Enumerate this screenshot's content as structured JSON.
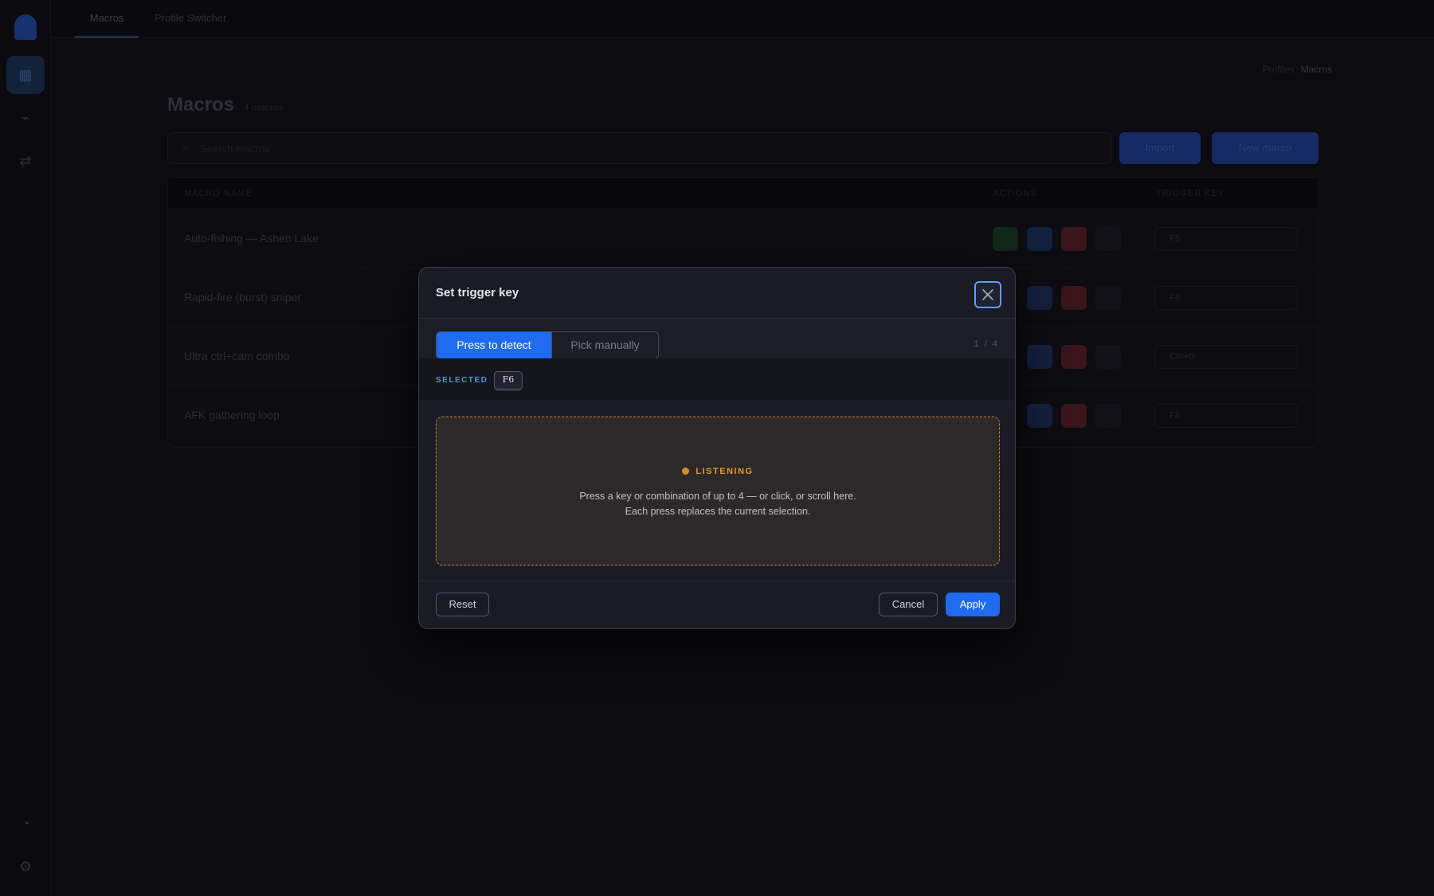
{
  "background": {
    "tabs": [
      "Macros",
      "Profile Switcher"
    ],
    "breadcrumb": {
      "parent": "Profiles",
      "current": "Macros"
    },
    "page_title": "Macros",
    "page_count": "4 macros",
    "search_placeholder": "Search macros",
    "import_label": "Import",
    "new_label": "New macro",
    "columns": [
      "MACRO NAME",
      "ACTIONS",
      "TRIGGER KEY"
    ],
    "rows": [
      {
        "name": "Auto-fishing — Ashen Lake",
        "key": "F5"
      },
      {
        "name": "Rapid-fire (burst) sniper",
        "key": "F6"
      },
      {
        "name": "Ultra ctrl+cam combo",
        "key": "Ctrl+G"
      },
      {
        "name": "AFK gathering loop",
        "key": "F8"
      }
    ]
  },
  "modal": {
    "title": "Set trigger key",
    "close_icon": "close-icon",
    "tabs": [
      {
        "label": "Press to detect",
        "active": true
      },
      {
        "label": "Pick manually",
        "active": false
      }
    ],
    "pager": "1 / 4",
    "selected_label": "SELECTED",
    "selected_key": "F6",
    "listening": {
      "title": "LISTENING",
      "line1": "Press a key or combination of up to 4 — or click, or scroll here.",
      "line2": "Each press replaces the current selection."
    },
    "reset_label": "Reset",
    "cancel_label": "Cancel",
    "apply_label": "Apply"
  },
  "colors": {
    "accent": "#1f6bf0",
    "listening": "#e0962e",
    "focus_ring": "#5aa0ff"
  }
}
